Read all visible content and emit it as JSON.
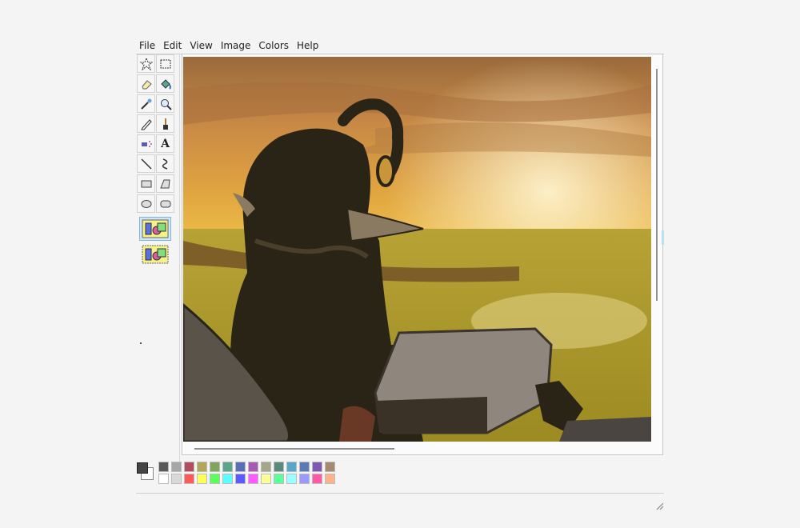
{
  "menu": [
    "File",
    "Edit",
    "View",
    "Image",
    "Colors",
    "Help"
  ],
  "tools": [
    {
      "name": "free-form-select-icon"
    },
    {
      "name": "select-icon"
    },
    {
      "name": "eraser-icon"
    },
    {
      "name": "fill-icon"
    },
    {
      "name": "pick-color-icon"
    },
    {
      "name": "magnifier-icon"
    },
    {
      "name": "pencil-icon"
    },
    {
      "name": "brush-icon"
    },
    {
      "name": "airbrush-icon"
    },
    {
      "name": "text-icon",
      "glyph": "A"
    },
    {
      "name": "line-icon"
    },
    {
      "name": "curve-icon"
    },
    {
      "name": "rectangle-icon"
    },
    {
      "name": "polygon-icon"
    },
    {
      "name": "ellipse-icon"
    },
    {
      "name": "rounded-rectangle-icon"
    }
  ],
  "options": [
    {
      "name": "opaque-selection-icon",
      "selected": true
    },
    {
      "name": "transparent-selection-icon",
      "selected": false
    }
  ],
  "current_colors": {
    "foreground": "#444444",
    "background": "#ffffff"
  },
  "palette": {
    "row1": [
      "#595959",
      "#a6a6a6",
      "#b34d5e",
      "#b3a659",
      "#7fa65a",
      "#5aa68a",
      "#5a6fb3",
      "#a65ab3",
      "#a6a68a",
      "#5a8a7a",
      "#5aa6c8",
      "#5a7ab3",
      "#7f5ab3",
      "#a68a6f"
    ],
    "row2": [
      "#ffffff",
      "#d9d9d9",
      "#ff5a5a",
      "#ffff5a",
      "#5aff5a",
      "#5affff",
      "#5a5aff",
      "#ff5aff",
      "#ffff99",
      "#5aff99",
      "#99ffff",
      "#9999ff",
      "#ff5aa6",
      "#ffb38a"
    ]
  }
}
